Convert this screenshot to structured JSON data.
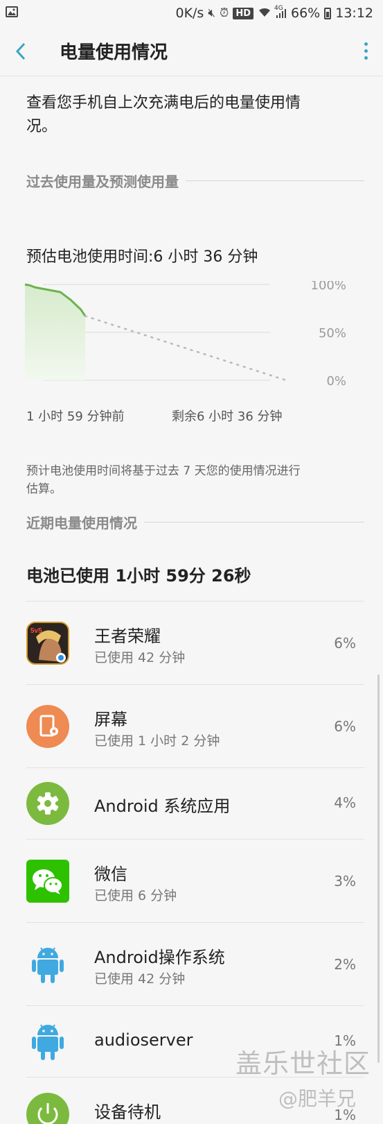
{
  "status_bar": {
    "speed": "0K/s",
    "hd": "HD",
    "network": "4G",
    "battery_percent": "66%",
    "time": "13:12"
  },
  "header": {
    "title": "电量使用情况"
  },
  "intro": "查看您手机自上次充满电后的电量使用情况。",
  "section_past": "过去使用量及预测使用量",
  "estimate": "预估电池使用时间:6 小时 36 分钟",
  "chart_data": {
    "type": "line",
    "y_tick_labels": [
      "100%",
      "50%",
      "0%"
    ],
    "ylim": [
      0,
      100
    ],
    "x_start_label": "1 小时 59 分钟前",
    "x_end_label": "剩余6 小时 36 分钟",
    "series": [
      {
        "x": [
          0,
          10,
          20,
          30,
          40,
          50,
          60,
          70,
          80,
          90,
          100,
          110,
          119
        ],
        "values": [
          100,
          99,
          97,
          96,
          95,
          94,
          93,
          92,
          88,
          84,
          79,
          74,
          67
        ]
      },
      {
        "x": [
          119,
          515
        ],
        "values": [
          67,
          0
        ]
      }
    ],
    "colors": {
      "line": "#6db24e",
      "fill": "#e3f1dc",
      "prediction": "#b8b8b8",
      "grid": "#d9d9d9"
    }
  },
  "note": "预计电池使用时间将基于过去 7 天您的使用情况进行估算。",
  "section_recent": "近期电量使用情况",
  "total_used": "电池已使用 1小时 59分 26秒",
  "apps": [
    {
      "name": "王者荣耀",
      "sub": "已使用 42 分钟",
      "pct": "6%",
      "icon": "game-icon"
    },
    {
      "name": "屏幕",
      "sub": "已使用 1 小时 2 分钟",
      "pct": "6%",
      "icon": "screen-icon"
    },
    {
      "name": "Android 系统应用",
      "sub": "",
      "pct": "4%",
      "icon": "settings-gear-icon"
    },
    {
      "name": "微信",
      "sub": "已使用 6 分钟",
      "pct": "3%",
      "icon": "wechat-icon"
    },
    {
      "name": "Android操作系统",
      "sub": "已使用 42 分钟",
      "pct": "2%",
      "icon": "android-icon"
    },
    {
      "name": "audioserver",
      "sub": "",
      "pct": "1%",
      "icon": "android-icon"
    },
    {
      "name": "设备待机",
      "sub": "",
      "pct": "1%",
      "icon": "power-icon"
    }
  ],
  "watermark": {
    "line1": "盖乐世社区",
    "line2": "@肥羊兄"
  }
}
